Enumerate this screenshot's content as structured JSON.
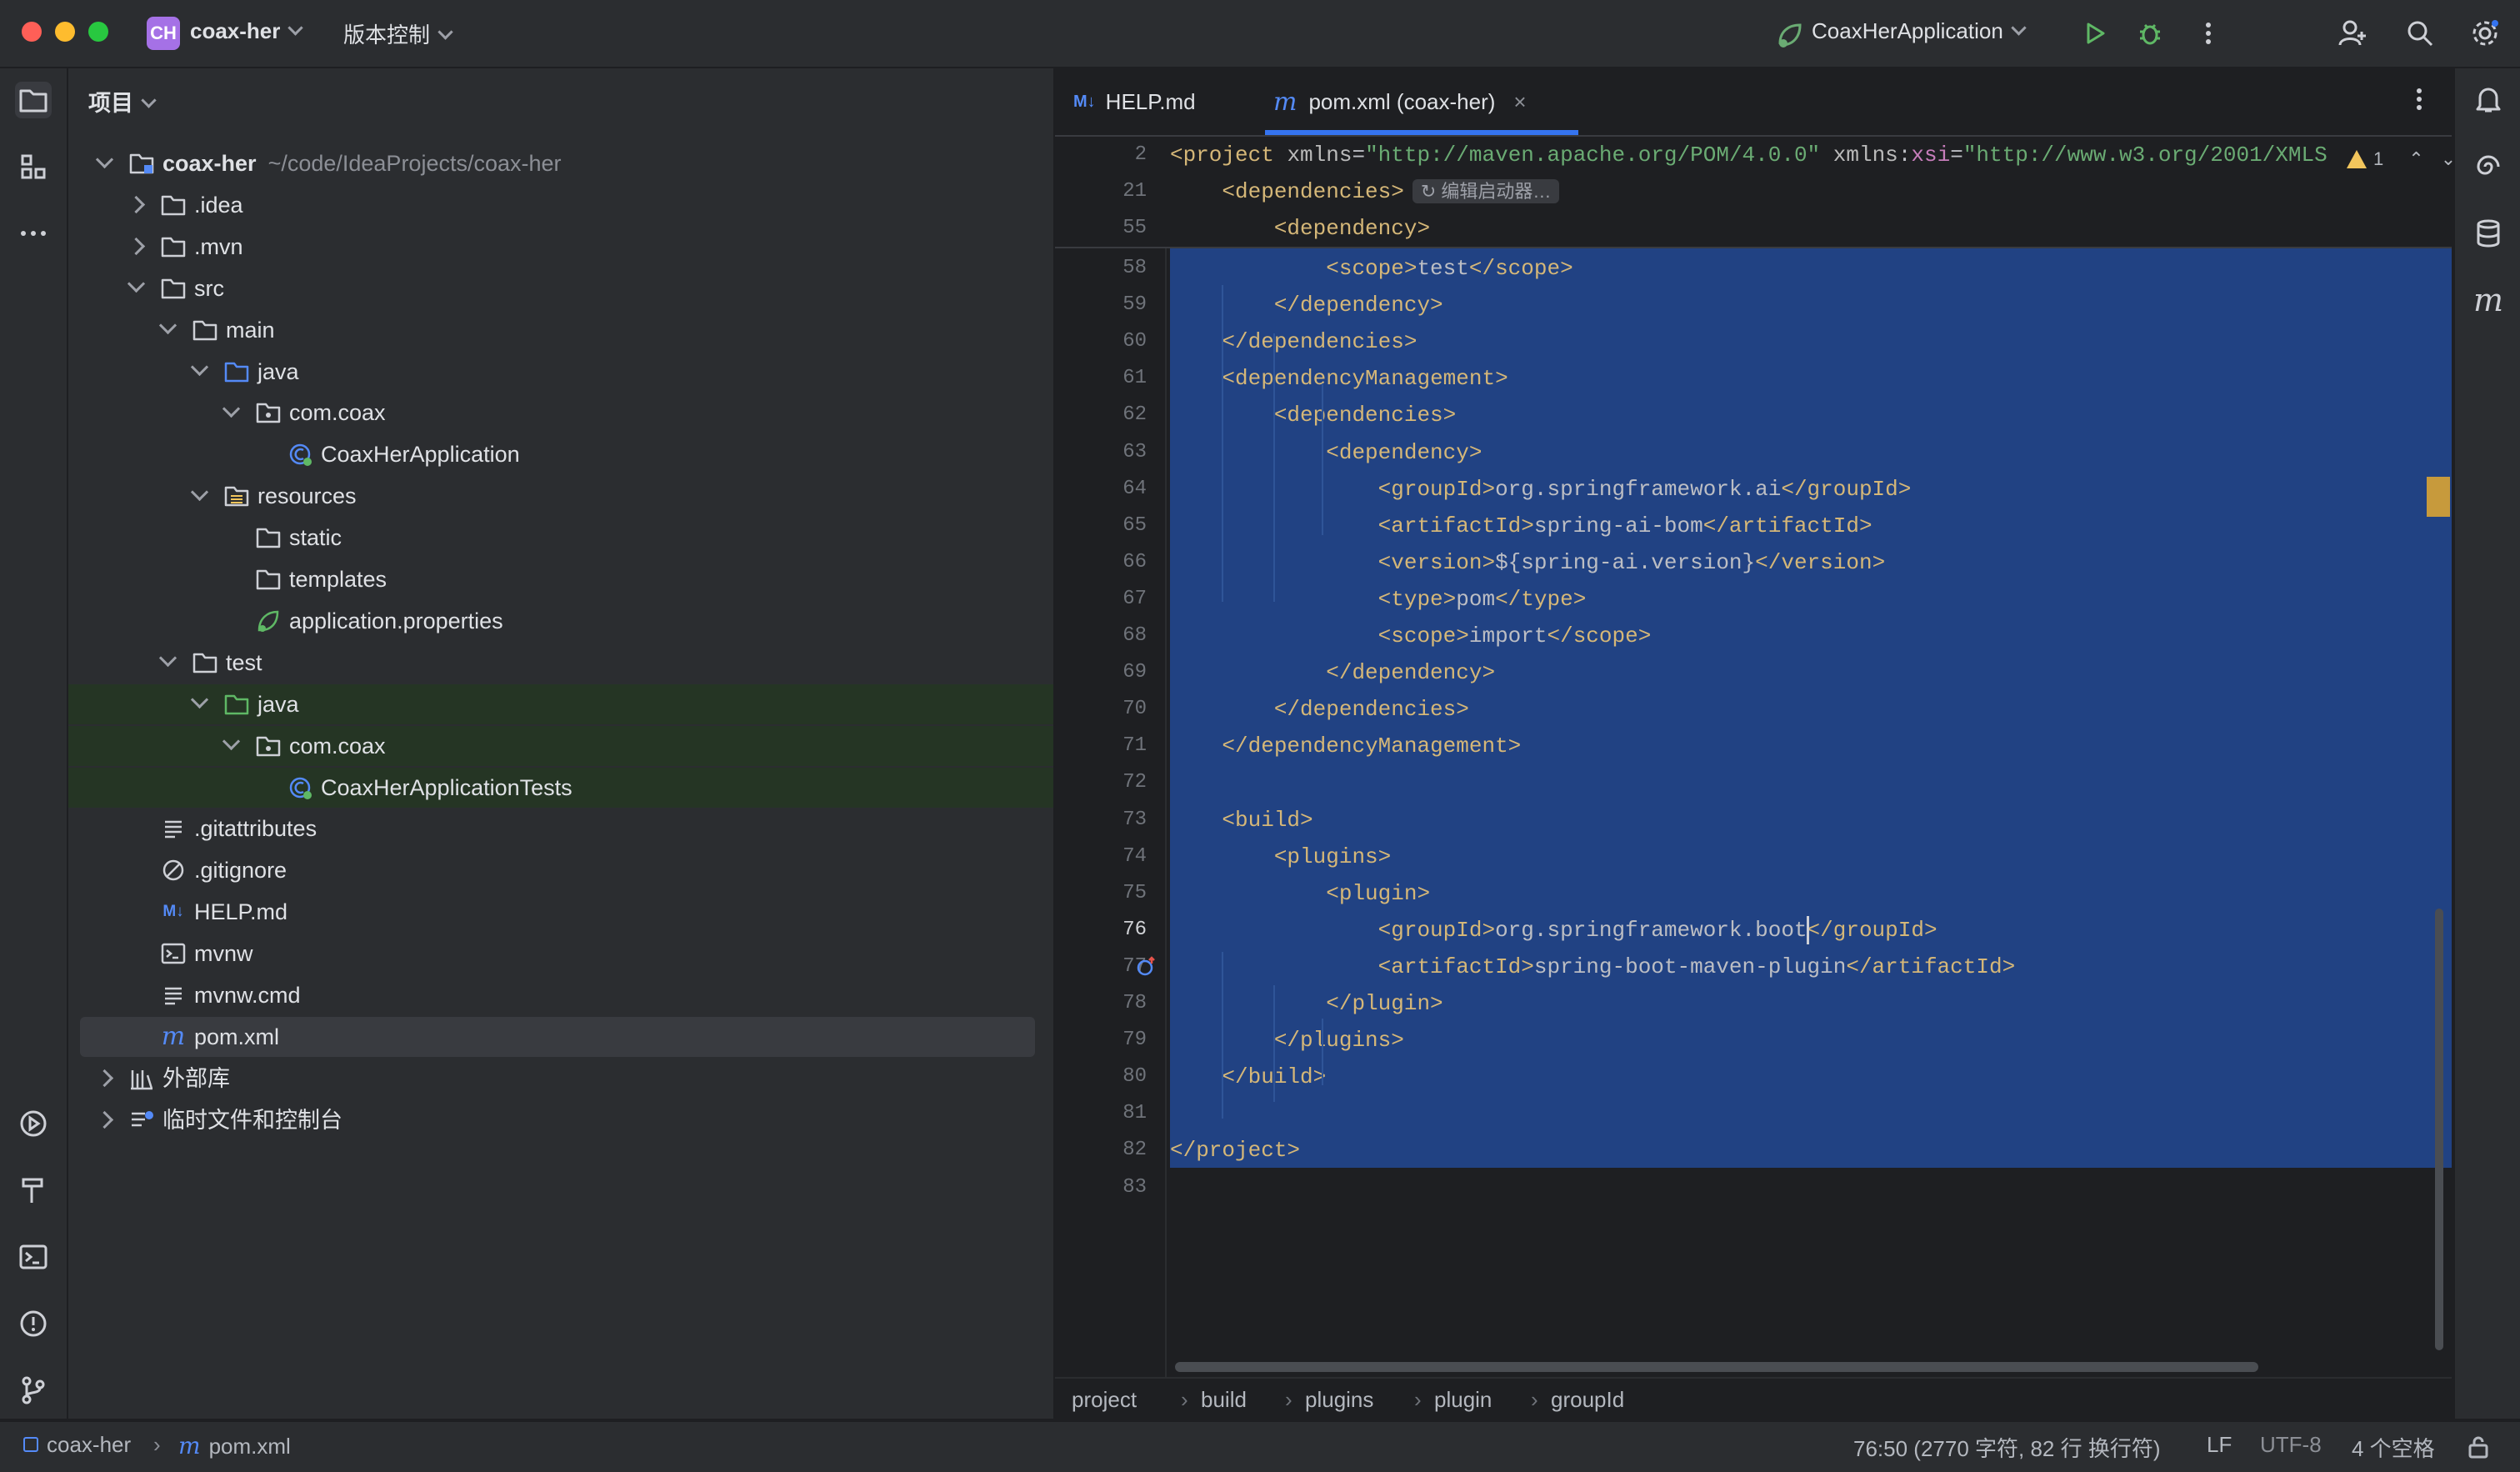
{
  "titlebar": {
    "project_badge": "CH",
    "project_name": "coax-her",
    "vcs_label": "版本控制",
    "run_config": "CoaxHerApplication"
  },
  "project_panel": {
    "title": "项目",
    "tree": [
      {
        "label": "coax-her",
        "hint": "~/code/IdeaProjects/coax-her",
        "level": 0,
        "arrow": "down",
        "icon": "module-folder-icon",
        "bold": true
      },
      {
        "label": ".idea",
        "level": 1,
        "arrow": "right",
        "icon": "folder-icon"
      },
      {
        "label": ".mvn",
        "level": 1,
        "arrow": "right",
        "icon": "folder-icon"
      },
      {
        "label": "src",
        "level": 1,
        "arrow": "down",
        "icon": "folder-icon"
      },
      {
        "label": "main",
        "level": 2,
        "arrow": "down",
        "icon": "folder-icon"
      },
      {
        "label": "java",
        "level": 3,
        "arrow": "down",
        "icon": "source-folder-icon"
      },
      {
        "label": "com.coax",
        "level": 4,
        "arrow": "down",
        "icon": "package-icon"
      },
      {
        "label": "CoaxHerApplication",
        "level": 5,
        "arrow": "none",
        "icon": "spring-class-icon"
      },
      {
        "label": "resources",
        "level": 3,
        "arrow": "down",
        "icon": "resources-folder-icon"
      },
      {
        "label": "static",
        "level": 4,
        "arrow": "none",
        "icon": "folder-icon"
      },
      {
        "label": "templates",
        "level": 4,
        "arrow": "none",
        "icon": "folder-icon"
      },
      {
        "label": "application.properties",
        "level": 4,
        "arrow": "none",
        "icon": "spring-properties-icon"
      },
      {
        "label": "test",
        "level": 2,
        "arrow": "down",
        "icon": "folder-icon"
      },
      {
        "label": "java",
        "level": 3,
        "arrow": "down",
        "icon": "test-folder-icon",
        "test": true
      },
      {
        "label": "com.coax",
        "level": 4,
        "arrow": "down",
        "icon": "package-icon",
        "test": true
      },
      {
        "label": "CoaxHerApplicationTests",
        "level": 5,
        "arrow": "none",
        "icon": "spring-class-icon",
        "test": true
      },
      {
        "label": ".gitattributes",
        "level": 1,
        "arrow": "none",
        "icon": "text-file-icon"
      },
      {
        "label": ".gitignore",
        "level": 1,
        "arrow": "none",
        "icon": "ignore-file-icon"
      },
      {
        "label": "HELP.md",
        "level": 1,
        "arrow": "none",
        "icon": "markdown-icon"
      },
      {
        "label": "mvnw",
        "level": 1,
        "arrow": "none",
        "icon": "shell-script-icon"
      },
      {
        "label": "mvnw.cmd",
        "level": 1,
        "arrow": "none",
        "icon": "text-file-icon"
      },
      {
        "label": "pom.xml",
        "level": 1,
        "arrow": "none",
        "icon": "maven-icon",
        "selected": true
      },
      {
        "label": "外部库",
        "level": 0,
        "arrow": "right",
        "icon": "library-icon"
      },
      {
        "label": "临时文件和控制台",
        "level": 0,
        "arrow": "right",
        "icon": "scratch-icon"
      }
    ]
  },
  "editor": {
    "tabs": [
      {
        "label": "HELP.md",
        "icon": "markdown-icon",
        "active": false
      },
      {
        "label": "pom.xml (coax-her)",
        "icon": "maven-icon",
        "active": true
      }
    ],
    "inlay_hint": "编辑启动器…",
    "warning_count": "1",
    "sticky_lines": [
      {
        "num": "2",
        "segments": [
          [
            "tag",
            "<project "
          ],
          [
            "attr",
            "xmlns"
          ],
          [
            "txt",
            "="
          ],
          [
            "str",
            "\"http://maven.apache.org/POM/4.0.0\""
          ],
          [
            "txt",
            " "
          ],
          [
            "attr",
            "xmlns"
          ],
          [
            "txt",
            ":"
          ],
          [
            "nsx",
            "xsi"
          ],
          [
            "txt",
            "="
          ],
          [
            "str",
            "\"http://www.w3.org/2001/XMLS"
          ]
        ]
      },
      {
        "num": "21",
        "segments": [
          [
            "txt",
            "    "
          ],
          [
            "tag",
            "<dependencies>"
          ]
        ]
      },
      {
        "num": "55",
        "segments": [
          [
            "txt",
            "        "
          ],
          [
            "tag",
            "<dependency>"
          ]
        ]
      }
    ],
    "lines": [
      {
        "num": "58",
        "segments": [
          [
            "txt",
            "            "
          ],
          [
            "tag",
            "<scope>"
          ],
          [
            "txt",
            "test"
          ],
          [
            "tag",
            "</scope>"
          ]
        ]
      },
      {
        "num": "59",
        "segments": [
          [
            "txt",
            "        "
          ],
          [
            "tag",
            "</dependency>"
          ]
        ]
      },
      {
        "num": "60",
        "segments": [
          [
            "txt",
            "    "
          ],
          [
            "tag",
            "</dependencies>"
          ]
        ]
      },
      {
        "num": "61",
        "segments": [
          [
            "txt",
            "    "
          ],
          [
            "tag",
            "<dependencyManagement>"
          ]
        ]
      },
      {
        "num": "62",
        "segments": [
          [
            "txt",
            "        "
          ],
          [
            "tag",
            "<dependencies>"
          ]
        ]
      },
      {
        "num": "63",
        "segments": [
          [
            "txt",
            "            "
          ],
          [
            "tag",
            "<dependency>"
          ]
        ]
      },
      {
        "num": "64",
        "segments": [
          [
            "txt",
            "                "
          ],
          [
            "tag",
            "<groupId>"
          ],
          [
            "txt",
            "org.springframework.ai"
          ],
          [
            "tag",
            "</groupId>"
          ]
        ]
      },
      {
        "num": "65",
        "segments": [
          [
            "txt",
            "                "
          ],
          [
            "tag",
            "<artifactId>"
          ],
          [
            "txt",
            "spring-ai-bom"
          ],
          [
            "tag",
            "</artifactId>"
          ]
        ]
      },
      {
        "num": "66",
        "segments": [
          [
            "txt",
            "                "
          ],
          [
            "tag",
            "<version>"
          ],
          [
            "txt",
            "${spring-ai.version}"
          ],
          [
            "tag",
            "</version>"
          ]
        ]
      },
      {
        "num": "67",
        "segments": [
          [
            "txt",
            "                "
          ],
          [
            "tag",
            "<type>"
          ],
          [
            "txt",
            "pom"
          ],
          [
            "tag",
            "</type>"
          ]
        ]
      },
      {
        "num": "68",
        "segments": [
          [
            "txt",
            "                "
          ],
          [
            "tag",
            "<scope>"
          ],
          [
            "txt",
            "import"
          ],
          [
            "tag",
            "</scope>"
          ]
        ]
      },
      {
        "num": "69",
        "segments": [
          [
            "txt",
            "            "
          ],
          [
            "tag",
            "</dependency>"
          ]
        ]
      },
      {
        "num": "70",
        "segments": [
          [
            "txt",
            "        "
          ],
          [
            "tag",
            "</dependencies>"
          ]
        ]
      },
      {
        "num": "71",
        "segments": [
          [
            "txt",
            "    "
          ],
          [
            "tag",
            "</dependencyManagement>"
          ]
        ]
      },
      {
        "num": "72",
        "segments": []
      },
      {
        "num": "73",
        "segments": [
          [
            "txt",
            "    "
          ],
          [
            "tag",
            "<build>"
          ]
        ]
      },
      {
        "num": "74",
        "segments": [
          [
            "txt",
            "        "
          ],
          [
            "tag",
            "<plugins>"
          ]
        ]
      },
      {
        "num": "75",
        "segments": [
          [
            "txt",
            "            "
          ],
          [
            "tag",
            "<plugin>"
          ]
        ]
      },
      {
        "num": "76",
        "segments": [
          [
            "txt",
            "                "
          ],
          [
            "tag",
            "<groupId>"
          ],
          [
            "txt",
            "org.springframework.boot"
          ],
          [
            "tag",
            "</groupId>"
          ]
        ]
      },
      {
        "num": "77",
        "segments": [
          [
            "txt",
            "                "
          ],
          [
            "tag",
            "<artifactId>"
          ],
          [
            "txt",
            "spring-boot-maven-plugin"
          ],
          [
            "tag",
            "</artifactId>"
          ]
        ]
      },
      {
        "num": "78",
        "segments": [
          [
            "txt",
            "            "
          ],
          [
            "tag",
            "</plugin>"
          ]
        ]
      },
      {
        "num": "79",
        "segments": [
          [
            "txt",
            "        "
          ],
          [
            "tag",
            "</plugins>"
          ]
        ]
      },
      {
        "num": "80",
        "segments": [
          [
            "txt",
            "    "
          ],
          [
            "tag",
            "</build>"
          ]
        ]
      },
      {
        "num": "81",
        "segments": []
      },
      {
        "num": "82",
        "segments": [
          [
            "tag",
            "</project>"
          ]
        ]
      },
      {
        "num": "83",
        "segments": []
      }
    ],
    "current_line": "76",
    "breadcrumbs": [
      "project",
      "build",
      "plugins",
      "plugin",
      "groupId"
    ]
  },
  "statusbar": {
    "project": "coax-her",
    "file": "pom.xml",
    "position": "76:50 (2770 字符, 82 行 换行符)",
    "line_sep": "LF",
    "encoding": "UTF-8",
    "indent": "4 个空格"
  },
  "colors": {
    "accent": "#3574f0",
    "selection": "#214283",
    "test_row": "#253524",
    "selected_row": "#393b40"
  }
}
